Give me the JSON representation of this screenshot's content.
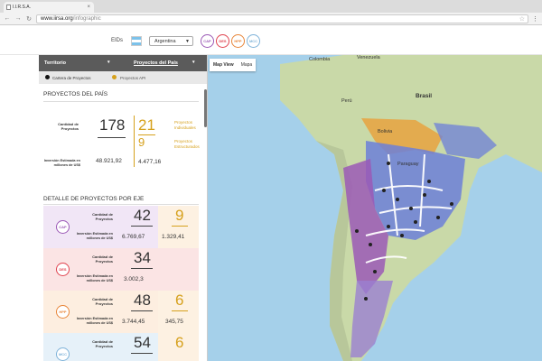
{
  "browser": {
    "tab_title": "I.I.R.S.A.",
    "url_domain": "www.iirsa.org",
    "url_path": "/infographic"
  },
  "topbar": {
    "eids_label": "EIDs",
    "country": "Argentina",
    "badges": [
      {
        "label": "CAP",
        "color": "#9b59b6"
      },
      {
        "label": "DES",
        "color": "#e0434f"
      },
      {
        "label": "HPP",
        "color": "#e8863a"
      },
      {
        "label": "MCC",
        "color": "#7fb3d9"
      }
    ]
  },
  "sidebar": {
    "tab_territorio": "Territorio",
    "tab_proyectos": "Proyectos del País",
    "legend_cartera": "Cartera de Proyectos",
    "legend_api": "Proyectos API",
    "legend_colors": {
      "cartera": "#111111",
      "api": "#d6a11d"
    },
    "proyectos_title": "PROYECTOS DEL PAÍS",
    "cantidad_label": "Cantidad de Proyectos",
    "cantidad_value": "178",
    "individuales_value": "21",
    "individuales_label": "Proyectos Individuales",
    "estructurados_value": "9",
    "estructurados_label": "Proyectos Estructurados",
    "inversion_label": "Inversión Estimada en millones de US$",
    "inversion_value": "48.921,92",
    "inversion_api_value": "4.477,16",
    "detalle_title": "DETALLE DE PROYECTOS POR EJE",
    "ejes": [
      {
        "code": "CAP",
        "color": "#9b59b6",
        "bg": "#f1e6f6",
        "bg_right": "#fdf1e2",
        "cantidad_label": "Cantidad de Proyectos",
        "cantidad": "42",
        "api": "9",
        "inversion_label": "Inversión Estimada en millones de US$",
        "inversion": "6.769,67",
        "inversion_api": "1.329,41"
      },
      {
        "code": "DES",
        "color": "#e0434f",
        "bg": "#fbe4e4",
        "bg_right": "#fbe4e4",
        "cantidad_label": "Cantidad de Proyectos",
        "cantidad": "34",
        "api": "",
        "inversion_label": "Inversión Estimada en millones de US$",
        "inversion": "3.002,3",
        "inversion_api": ""
      },
      {
        "code": "HPP",
        "color": "#e8863a",
        "bg": "#fdeee0",
        "bg_right": "#fdf1e2",
        "cantidad_label": "Cantidad de Proyectos",
        "cantidad": "48",
        "api": "6",
        "inversion_label": "Inversión Estimada en millones de US$",
        "inversion": "3.744,45",
        "inversion_api": "345,75"
      },
      {
        "code": "MCC",
        "color": "#7fb3d9",
        "bg": "#e6f1f9",
        "bg_right": "#fdf1e2",
        "cantidad_label": "Cantidad de Proyectos",
        "cantidad": "54",
        "api": "6"
      }
    ]
  },
  "map": {
    "tab_active": "Map View",
    "tab_other": "Mapa",
    "labels": {
      "brazil": "Brasil",
      "bolivia": "Bolivia",
      "paraguay": "Paraguay",
      "peru": "Perú",
      "colombia": "Colombia",
      "venezuela": "Venezuela"
    },
    "colors": {
      "ocean": "#a5d0ea",
      "land": "#c9d9a8",
      "purple": "#9b59b6",
      "orange": "#e8a240",
      "blue": "#6c7fd8"
    }
  }
}
